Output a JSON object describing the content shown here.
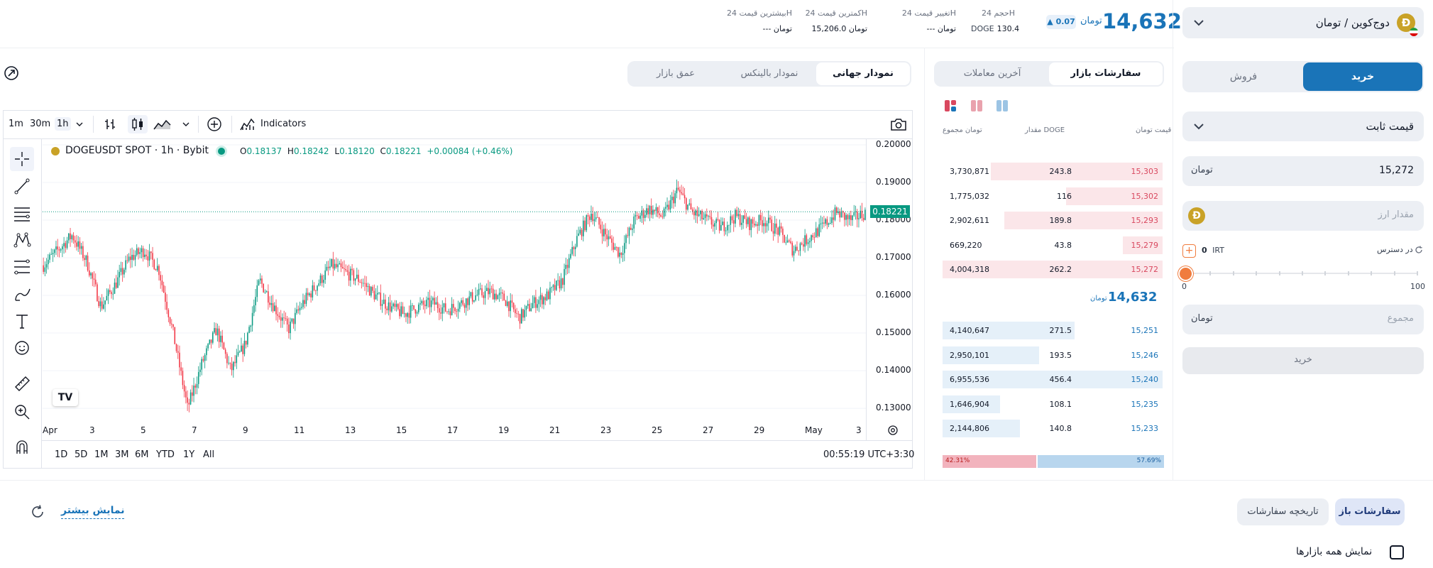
{
  "header": {
    "price": "14,632",
    "change": "0.07",
    "stats": [
      {
        "label": "حجم 24H",
        "value": "130.4",
        "unit": "DOGE"
      },
      {
        "label": "تغییر قیمت 24H",
        "value": "---"
      },
      {
        "label": "کمترین قیمت 24H",
        "value": "15,206.0"
      },
      {
        "label": "بیشترین قیمت 24H",
        "value": "---"
      }
    ]
  },
  "market": {
    "selector_label": "دوج‌کوین / تومان"
  },
  "trade": {
    "buy_tab": "خرید",
    "sell_tab": "فروش",
    "order_type": "قیمت ثابت",
    "price_value": "15,272",
    "amount_placeholder": "مقدار ارز",
    "available_label": "در دسترس",
    "available_value": "0",
    "available_unit": "IRT",
    "slider_min": "0",
    "slider_max": "100",
    "slider_value_percent": 0,
    "total_placeholder": "مجموع",
    "submit_label": "خرید"
  },
  "orderbook": {
    "tabs": [
      "سفارشات بازار",
      "آخرین معاملات"
    ],
    "headers": {
      "price": "قیمت",
      "amount": "مقدار DOGE",
      "total": "مجموع"
    },
    "asks": [
      {
        "price": "15,303",
        "amount": "243.8",
        "total": "3,730,871",
        "depth": 0.78
      },
      {
        "price": "15,302",
        "amount": "116",
        "total": "1,775,032",
        "depth": 0.44
      },
      {
        "price": "15,293",
        "amount": "189.8",
        "total": "2,902,611",
        "depth": 0.72
      },
      {
        "price": "15,279",
        "amount": "43.8",
        "total": "669,220",
        "depth": 0.18
      },
      {
        "price": "15,272",
        "amount": "262.2",
        "total": "4,004,318",
        "depth": 1.0
      }
    ],
    "mid_price": "14,632",
    "bids": [
      {
        "price": "15,251",
        "amount": "271.5",
        "total": "4,140,647",
        "depth": 0.6
      },
      {
        "price": "15,246",
        "amount": "193.5",
        "total": "2,950,101",
        "depth": 0.44
      },
      {
        "price": "15,240",
        "amount": "456.4",
        "total": "6,955,536",
        "depth": 1.0
      },
      {
        "price": "15,235",
        "amount": "108.1",
        "total": "1,646,904",
        "depth": 0.26
      },
      {
        "price": "15,233",
        "amount": "140.8",
        "total": "2,144,806",
        "depth": 0.35
      }
    ],
    "ratio_sell": "42.31%",
    "ratio_buy": "57.69%"
  },
  "chart_tabs": [
    "نمودار جهانی",
    "نمودار بالینکس",
    "عمق بازار"
  ],
  "chart_toolbar": {
    "timeframes": [
      "1m",
      "30m",
      "1h"
    ],
    "indicators_label": "Indicators"
  },
  "chart_legend": {
    "symbol": "DOGEUSDT SPOT · 1h · Bybit",
    "o_label": "O",
    "o": "0.18137",
    "h_label": "H",
    "h": "0.18242",
    "l_label": "L",
    "l": "0.18120",
    "c_label": "C",
    "c": "0.18221",
    "change": "+0.00084 (+0.46%)"
  },
  "chart_data": {
    "type": "candlestick",
    "title": "DOGEUSDT SPOT · 1h · Bybit",
    "x_ticks": [
      "Apr",
      "3",
      "5",
      "7",
      "9",
      "11",
      "13",
      "15",
      "17",
      "19",
      "21",
      "23",
      "25",
      "27",
      "29",
      "May",
      "3"
    ],
    "y_ticks": [
      "0.20000",
      "0.19000",
      "0.18000",
      "0.17000",
      "0.16000",
      "0.15000",
      "0.14000",
      "0.13000"
    ],
    "ylim": [
      0.127,
      0.2015
    ],
    "last_price": "0.18221",
    "closes_approx": [
      0.168,
      0.172,
      0.176,
      0.169,
      0.157,
      0.163,
      0.17,
      0.172,
      0.167,
      0.15,
      0.13,
      0.142,
      0.151,
      0.14,
      0.147,
      0.164,
      0.157,
      0.151,
      0.158,
      0.163,
      0.168,
      0.166,
      0.164,
      0.16,
      0.157,
      0.155,
      0.157,
      0.158,
      0.156,
      0.158,
      0.16,
      0.161,
      0.159,
      0.154,
      0.158,
      0.16,
      0.164,
      0.175,
      0.182,
      0.176,
      0.171,
      0.18,
      0.183,
      0.181,
      0.188,
      0.182,
      0.18,
      0.178,
      0.181,
      0.179,
      0.18,
      0.177,
      0.172,
      0.175,
      0.178,
      0.182,
      0.18,
      0.182
    ]
  },
  "chart_footer": {
    "ranges": [
      "1D",
      "5D",
      "1M",
      "3M",
      "6M",
      "YTD",
      "1Y",
      "All"
    ],
    "time": "00:55:19 UTC+3:30"
  },
  "bottom": {
    "open_orders": "سفارشات باز",
    "order_history": "تاریخچه سفارشات",
    "show_all_markets": "نمایش همه بازارها",
    "show_more": "نمایش بیشتر"
  }
}
